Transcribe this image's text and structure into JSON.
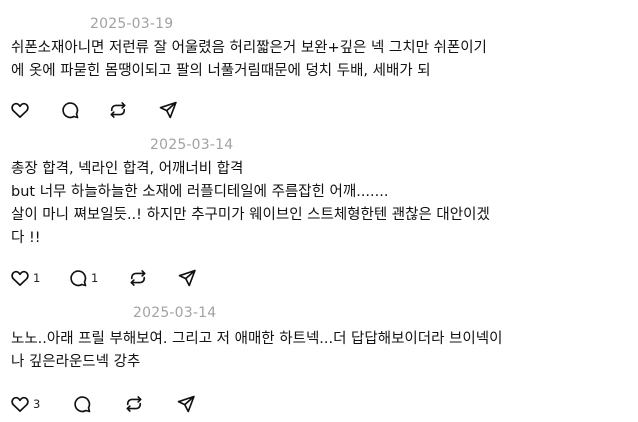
{
  "comments": [
    {
      "date": "2025-03-19",
      "lines": [
        "쉬폰소재아니면 저런류 잘 어울렸음 허리짧은거 보완+깊은 넥 그치만 쉬폰이기",
        "에 옷에 파묻힌 몸땡이되고 팔의 너풀거림때문에 덩치 두배, 세배가 되"
      ],
      "likes": "",
      "replies": ""
    },
    {
      "date": "2025-03-14",
      "lines": [
        "총장 합격, 넥라인 합격, 어깨너비 합격",
        "but 너무 하늘하늘한 소재에 러플디테일에 주름잡힌 어깨.......",
        "살이 마니 쪄보일듯..! 하지만 추구미가 웨이브인 스트체형한텐 괜찮은 대안이겠",
        "다 !!"
      ],
      "likes": "1",
      "replies": "1"
    },
    {
      "date": "2025-03-14",
      "lines": [
        "노노..아래 프릴 부해보여. 그리고 저 애매한 하트넥...더 답답해보이더라 브이넥이",
        "나 깊은라운드넥 강추"
      ],
      "likes": "3",
      "replies": ""
    }
  ],
  "icons": {
    "like": "heart-icon",
    "reply": "comment-bubble-icon",
    "repost": "repost-icon",
    "share": "send-icon"
  }
}
